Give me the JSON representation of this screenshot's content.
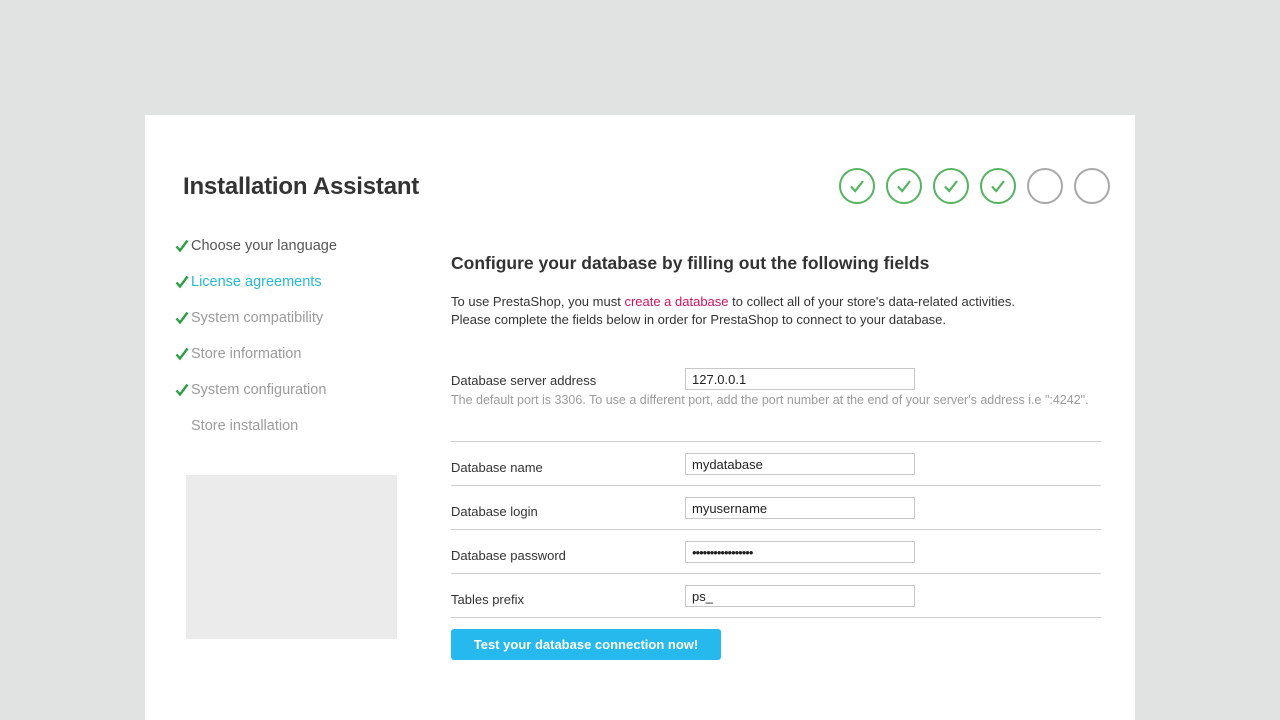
{
  "app": {
    "title": "Installation Assistant"
  },
  "progress": {
    "completed_steps": 4,
    "total_steps": 6,
    "accent_color": "#55b461",
    "pending_color": "#a8a8a8"
  },
  "sidebar": {
    "items": [
      {
        "label": "Choose your language",
        "done": true
      },
      {
        "label": "License agreements",
        "done": true
      },
      {
        "label": "System compatibility",
        "done": true
      },
      {
        "label": "Store information",
        "done": true
      },
      {
        "label": "System configuration",
        "done": true
      },
      {
        "label": "Store installation",
        "done": false
      }
    ]
  },
  "main": {
    "heading": "Configure your database by filling out the following fields",
    "intro": {
      "line1_before": "To use PrestaShop, you must ",
      "line1_link": "create a database",
      "line1_after": " to collect all of your store's data-related activities.",
      "line2": "Please complete the fields below in order for PrestaShop to connect to your database."
    },
    "fields": {
      "server": {
        "label": "Database server address",
        "value": "127.0.0.1",
        "hint": "The default port is 3306. To use a different port, add the port number at the end of your server's address i.e \":4242\"."
      },
      "name": {
        "label": "Database name",
        "value": "mydatabase"
      },
      "login": {
        "label": "Database login",
        "value": "myusername"
      },
      "password": {
        "label": "Database password",
        "value": "•••••••••••••••••"
      },
      "prefix": {
        "label": "Tables prefix",
        "value": "ps_"
      }
    },
    "test_button": "Test your database connection now!"
  }
}
